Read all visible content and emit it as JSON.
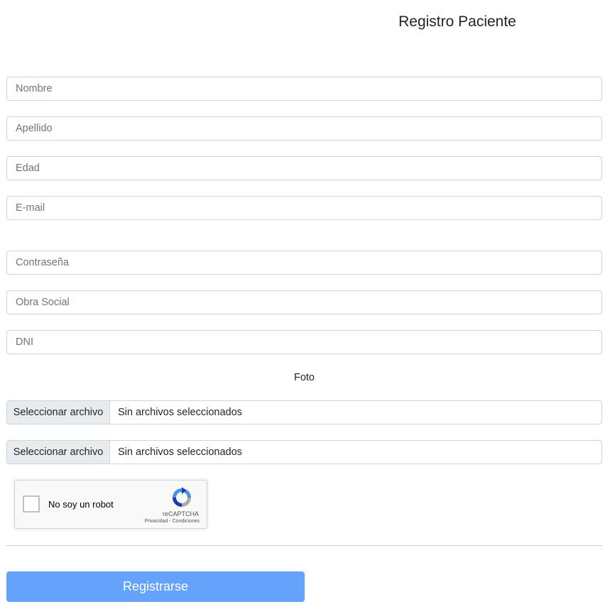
{
  "page": {
    "title": "Registro Paciente"
  },
  "form": {
    "nombre_placeholder": "Nombre",
    "apellido_placeholder": "Apellido",
    "edad_placeholder": "Edad",
    "email_placeholder": "E-mail",
    "password_placeholder": "Contraseña",
    "obra_social_placeholder": "Obra Social",
    "dni_placeholder": "DNI",
    "foto_label": "Foto",
    "file_inputs": [
      {
        "button_label": "Seleccionar archivo",
        "status": "Sin archivos seleccionados"
      },
      {
        "button_label": "Seleccionar archivo",
        "status": "Sin archivos seleccionados"
      }
    ]
  },
  "recaptcha": {
    "label": "No soy un robot",
    "brand": "reCAPTCHA",
    "terms": "Privacidad - Condiciones",
    "icon": "recaptcha-logo-icon"
  },
  "submit": {
    "label": "Registrarse"
  },
  "colors": {
    "primary_button": "#64a2fc",
    "input_border": "#ced4da",
    "file_button_bg": "#e9ecef"
  }
}
